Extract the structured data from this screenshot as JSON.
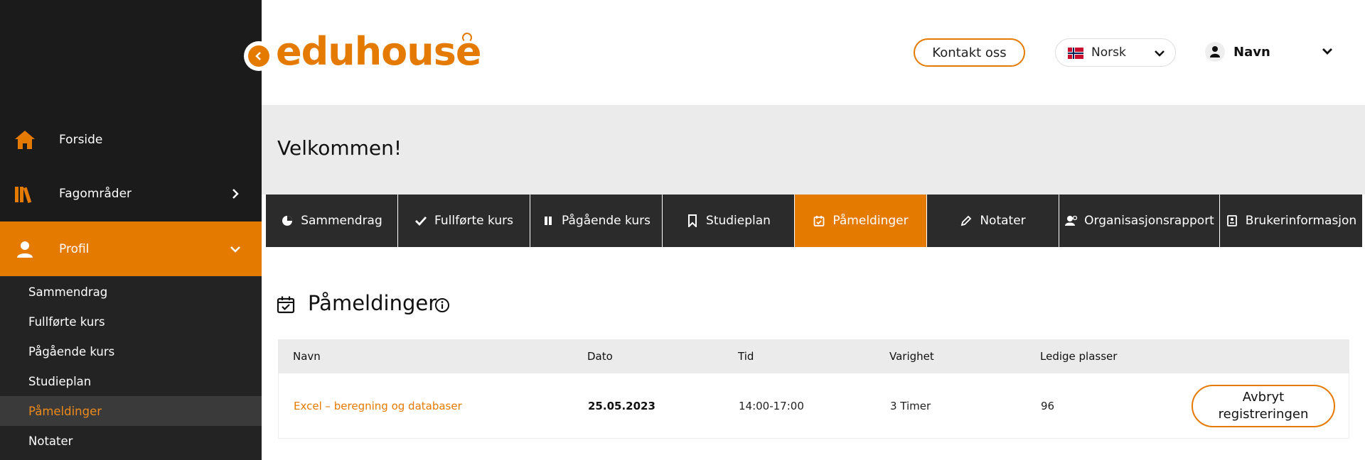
{
  "sidebar": {
    "main_items": [
      {
        "label": "Forside",
        "icon": "home-icon"
      },
      {
        "label": "Fagområder",
        "icon": "books-icon"
      },
      {
        "label": "Profil",
        "icon": "user-icon"
      }
    ],
    "sub_items": [
      {
        "label": "Sammendrag"
      },
      {
        "label": "Fullførte kurs"
      },
      {
        "label": "Pågående kurs"
      },
      {
        "label": "Studieplan"
      },
      {
        "label": "Påmeldinger"
      },
      {
        "label": "Notater"
      }
    ],
    "active_sub": "Påmeldinger"
  },
  "header": {
    "logo_text": "eduhouse",
    "contact_label": "Kontakt oss",
    "language": "Norsk",
    "user_name": "Navn"
  },
  "welcome": {
    "title": "Velkommen!"
  },
  "tabs": [
    {
      "label": "Sammendrag",
      "icon": "pie-chart-icon"
    },
    {
      "label": "Fullførte kurs",
      "icon": "check-icon"
    },
    {
      "label": "Pågående kurs",
      "icon": "pause-icon"
    },
    {
      "label": "Studieplan",
      "icon": "bookmark-icon"
    },
    {
      "label": "Påmeldinger",
      "icon": "calendar-check-icon"
    },
    {
      "label": "Notater",
      "icon": "pencil-icon"
    },
    {
      "label": "Organisasjonsrapport",
      "icon": "org-user-icon"
    },
    {
      "label": "Brukerinformasjon",
      "icon": "id-card-icon"
    }
  ],
  "active_tab": "Påmeldinger",
  "section": {
    "title": "Påmeldinger"
  },
  "table": {
    "headers": [
      "Navn",
      "Dato",
      "Tid",
      "Varighet",
      "Ledige plasser"
    ],
    "rows": [
      {
        "name": "Excel – beregning og databaser",
        "date": "25.05.2023",
        "time": "14:00-17:00",
        "duration": "3 Timer",
        "seats": "96",
        "action": "Avbryt registreringen"
      }
    ]
  },
  "colors": {
    "accent": "#e57a00",
    "sidebar_bg": "#1b1b1b",
    "tab_bg": "#2b2b2b"
  }
}
